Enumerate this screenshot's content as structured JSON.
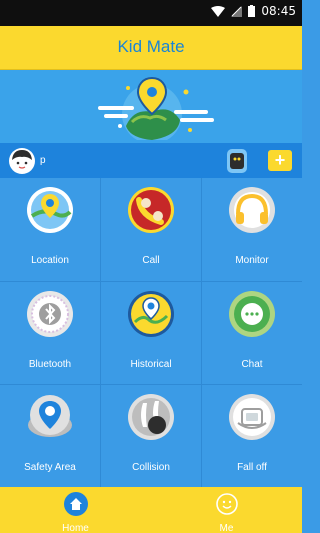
{
  "status_bar": {
    "time": "08:45"
  },
  "header": {
    "title": "Kid Mate"
  },
  "user_bar": {
    "username": "p",
    "add_label": "+"
  },
  "grid": [
    {
      "label": "Location"
    },
    {
      "label": "Call"
    },
    {
      "label": "Monitor"
    },
    {
      "label": "Bluetooth"
    },
    {
      "label": "Historical"
    },
    {
      "label": "Chat"
    },
    {
      "label": "Safety Area"
    },
    {
      "label": "Collision"
    },
    {
      "label": "Fall off"
    }
  ],
  "tabs": [
    {
      "label": "Home",
      "active": true
    },
    {
      "label": "Me",
      "active": false
    }
  ],
  "colors": {
    "accent_yellow": "#fbd92e",
    "brand_blue": "#1e83dc",
    "grid_blue": "#3b9be6"
  }
}
